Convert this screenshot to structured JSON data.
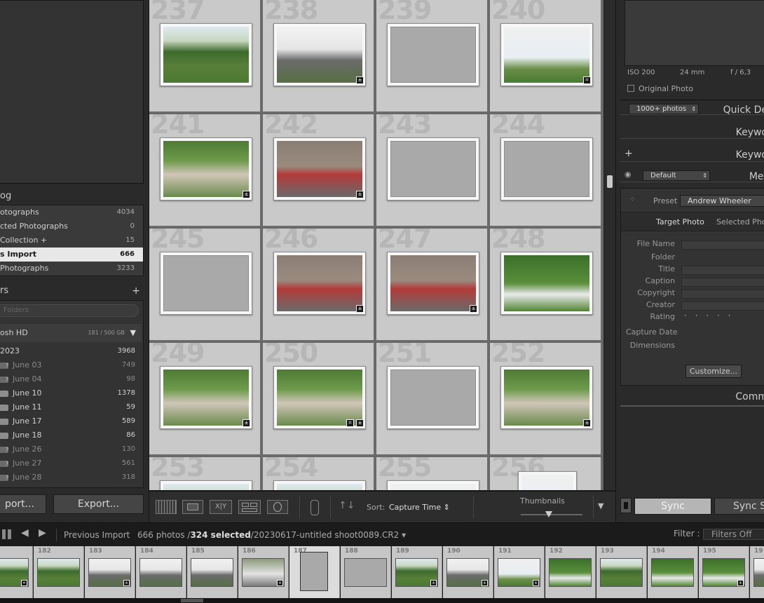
{
  "left_panel": {
    "catalog_header": "og",
    "catalog_items": [
      {
        "label": "otographs",
        "count": "4034",
        "active": false
      },
      {
        "label": "cted Photographs",
        "count": "0",
        "active": false
      },
      {
        "label": "Collection  +",
        "count": "15",
        "active": false
      },
      {
        "label": "s Import",
        "count": "666",
        "active": true
      },
      {
        "label": " Photographs",
        "count": "3233",
        "active": false
      }
    ],
    "folders_header": "rs",
    "folder_search_placeholder": "Folders",
    "volume": {
      "name": "osh HD",
      "capacity": "181 / 500 GB"
    },
    "year": {
      "label": "2023",
      "count": "3968"
    },
    "folders": [
      {
        "label": "June 03",
        "count": "749",
        "dim": true
      },
      {
        "label": "June 04",
        "count": "98",
        "dim": true
      },
      {
        "label": "June 10",
        "count": "1378",
        "dim": false
      },
      {
        "label": "June 11",
        "count": "59",
        "dim": false
      },
      {
        "label": "June 17",
        "count": "589",
        "dim": false
      },
      {
        "label": "June 18",
        "count": "86",
        "dim": false
      },
      {
        "label": "June 26",
        "count": "130",
        "dim": true
      },
      {
        "label": "June 27",
        "count": "561",
        "dim": true
      },
      {
        "label": "June 28",
        "count": "318",
        "dim": true
      }
    ],
    "import_button": "port...",
    "export_button": "Export..."
  },
  "grid": {
    "cells": [
      {
        "num": "237",
        "type": "s-green",
        "badge": ""
      },
      {
        "num": "238",
        "type": "s-people",
        "badge": "edit"
      },
      {
        "num": "239",
        "type": "placeholder",
        "badge": ""
      },
      {
        "num": "240",
        "type": "s-sky",
        "badge": "crop"
      },
      {
        "num": "241",
        "type": "s-crowd",
        "badge": "edit"
      },
      {
        "num": "242",
        "type": "s-brick",
        "badge": "edit"
      },
      {
        "num": "243",
        "type": "placeholder",
        "badge": ""
      },
      {
        "num": "244",
        "type": "placeholder",
        "badge": ""
      },
      {
        "num": "245",
        "type": "placeholder",
        "badge": ""
      },
      {
        "num": "246",
        "type": "s-brick",
        "badge": "edit"
      },
      {
        "num": "247",
        "type": "s-brick",
        "badge": "edit"
      },
      {
        "num": "248",
        "type": "s-lawn",
        "badge": ""
      },
      {
        "num": "249",
        "type": "s-crowd",
        "badge": "edit"
      },
      {
        "num": "250",
        "type": "s-crowd",
        "badge": "crop+edit"
      },
      {
        "num": "251",
        "type": "placeholder",
        "badge": ""
      },
      {
        "num": "252",
        "type": "s-crowd",
        "badge": "edit"
      },
      {
        "num": "253",
        "type": "s-green",
        "badge": ""
      },
      {
        "num": "254",
        "type": "s-green",
        "badge": ""
      },
      {
        "num": "255",
        "type": "s-sky",
        "badge": ""
      },
      {
        "num": "256",
        "type": "s-sky",
        "badge": "tall"
      }
    ]
  },
  "toolbar": {
    "sort_label": "Sort:",
    "sort_value": "Capture Time",
    "thumbnails_label": "Thumbnails",
    "thumbnail_size": 0.45
  },
  "right_panel": {
    "iso": "ISO 200",
    "focal": "24 mm",
    "aperture": "f / 6,3",
    "original_photo": "Original Photo",
    "photo_count_select": "1000+ photos",
    "quick_develop": "Quick De",
    "keywording": "Keywo",
    "keyword_list": "Keywo",
    "meta_preset_select": "Default",
    "metadata_title": "Met",
    "preset_label": "Preset",
    "preset_value": "Andrew Wheeler",
    "target_tab": "Target Photo",
    "selected_tab": "Selected Photo",
    "fields": [
      "File Name",
      "Folder",
      "Title",
      "Caption",
      "Copyright",
      "Creator",
      "Rating",
      "Capture Date",
      "Dimensions"
    ],
    "rating_dots": "· · · · ·",
    "customize_button": "Customize...",
    "comments_title": "Comm",
    "sync_button": "Sync",
    "sync_settings_button": "Sync Se"
  },
  "filmstrip_bar": {
    "source": "Previous Import",
    "count_text": "666 photos /",
    "selected_text": "324 selected",
    "file_text": "/20230617-untitled shoot0089.CR2",
    "filter_label": "Filter :",
    "filter_value": "Filters Off"
  },
  "filmstrip": [
    {
      "num": "",
      "type": "s-green",
      "badge": "crop"
    },
    {
      "num": "182",
      "type": "s-green",
      "badge": ""
    },
    {
      "num": "183",
      "type": "s-people",
      "badge": "edit"
    },
    {
      "num": "184",
      "type": "s-people",
      "badge": ""
    },
    {
      "num": "185",
      "type": "s-people",
      "badge": ""
    },
    {
      "num": "186",
      "type": "s-mix",
      "badge": "edit"
    },
    {
      "num": "187",
      "type": "placeholder-sel",
      "badge": ""
    },
    {
      "num": "188",
      "type": "placeholder",
      "badge": ""
    },
    {
      "num": "189",
      "type": "s-green",
      "badge": "edit"
    },
    {
      "num": "190",
      "type": "s-people",
      "badge": "edit"
    },
    {
      "num": "191",
      "type": "s-sky",
      "badge": "edit"
    },
    {
      "num": "192",
      "type": "s-lawn",
      "badge": ""
    },
    {
      "num": "193",
      "type": "s-green",
      "badge": ""
    },
    {
      "num": "194",
      "type": "s-lawn",
      "badge": ""
    },
    {
      "num": "195",
      "type": "s-lawn",
      "badge": "edit"
    },
    {
      "num": "19",
      "type": "s-people",
      "badge": ""
    }
  ]
}
